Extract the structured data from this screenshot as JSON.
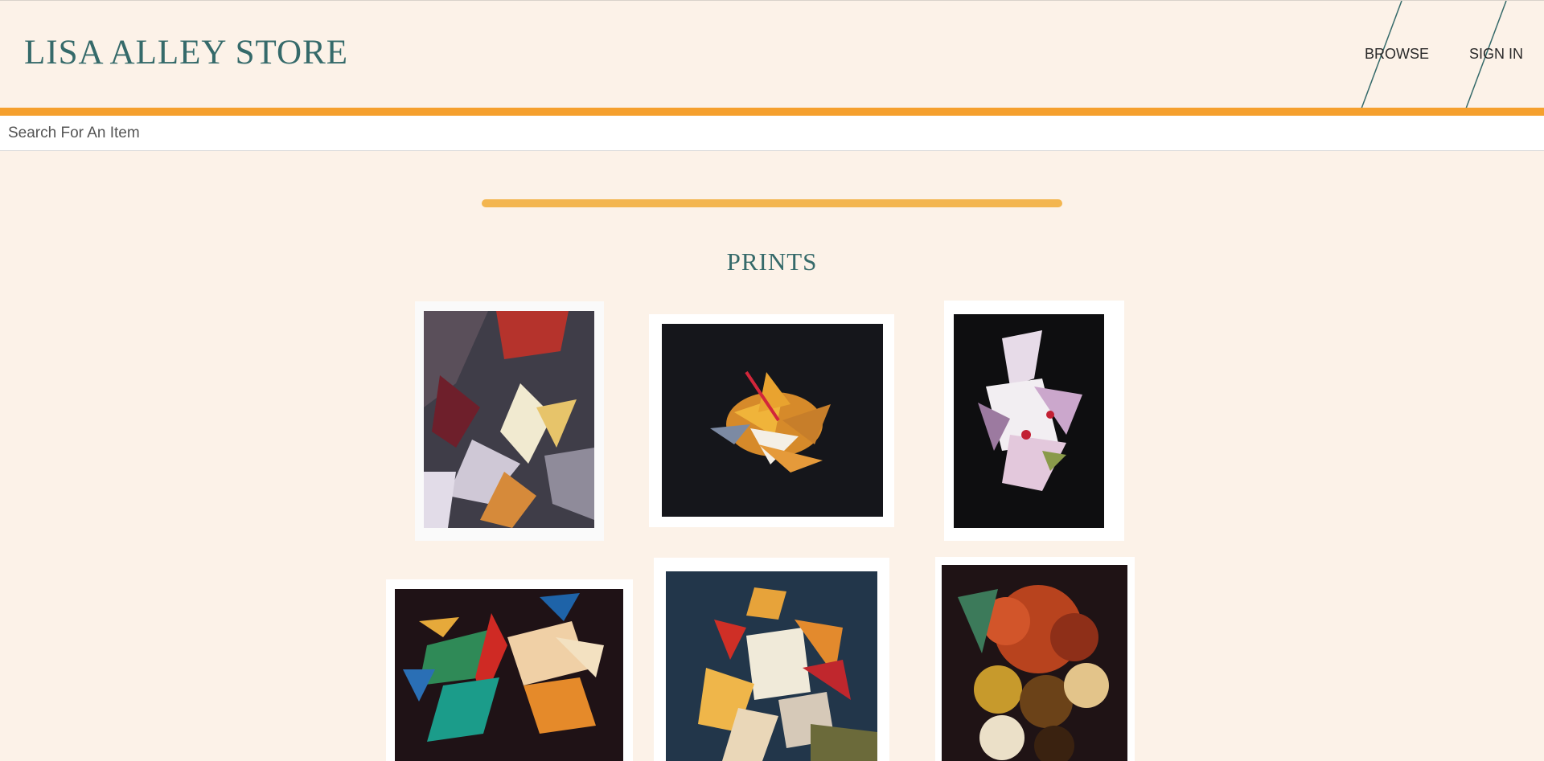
{
  "header": {
    "brand": "LISA ALLEY STORE",
    "nav": {
      "browse": "BROWSE",
      "sign_in": "SIGN IN"
    }
  },
  "search": {
    "placeholder": "Search For An Item",
    "value": ""
  },
  "section": {
    "title": "PRINTS"
  },
  "colors": {
    "background": "#fcf2e8",
    "accent_orange": "#f5a02e",
    "divider_yellow": "#f3b650",
    "brand_teal": "#356a6a"
  },
  "prints": [
    {
      "name": "print-1"
    },
    {
      "name": "print-2"
    },
    {
      "name": "print-3"
    },
    {
      "name": "print-4"
    },
    {
      "name": "print-5"
    },
    {
      "name": "print-6"
    }
  ]
}
